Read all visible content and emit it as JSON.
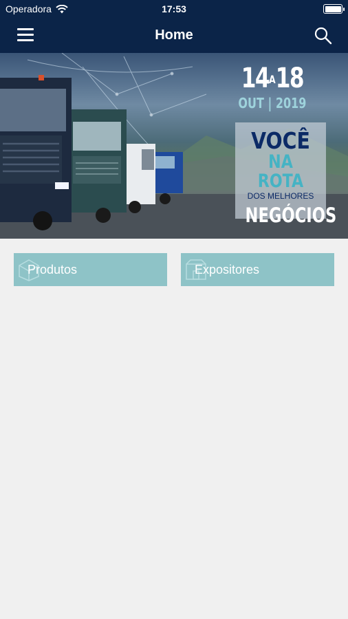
{
  "status_bar": {
    "carrier": "Operadora",
    "time": "17:53"
  },
  "nav": {
    "title": "Home"
  },
  "banner": {
    "date_days": "14",
    "date_connector": "A",
    "date_days_end": "18",
    "date_month": "OUT | 2019",
    "slogan_line1": "VOCÊ",
    "slogan_line2": "NA ROTA",
    "slogan_line3": "DOS MELHORES",
    "slogan_line4": "NEGÓCIOS"
  },
  "buttons": {
    "produtos": "Produtos",
    "expositores": "Expositores"
  },
  "colors": {
    "nav_bg": "#0b2448",
    "button_bg": "#8ec3c7",
    "page_bg": "#f0f0f0"
  },
  "icons": [
    "wifi-icon",
    "battery-icon",
    "menu-icon",
    "search-icon",
    "box-icon",
    "store-icon"
  ]
}
